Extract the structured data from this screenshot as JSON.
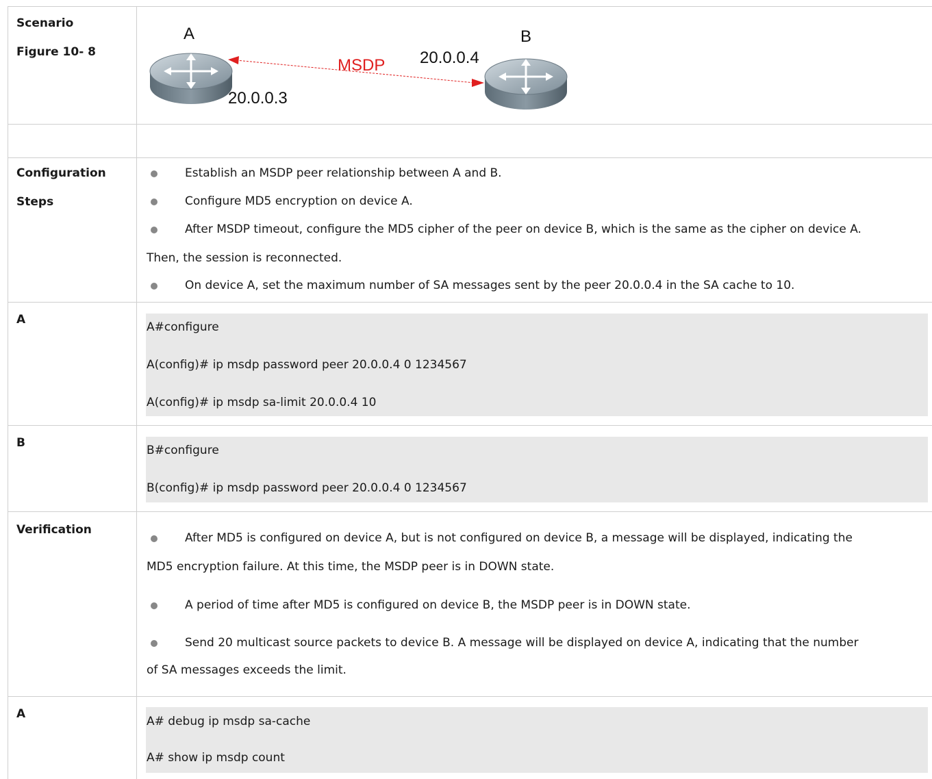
{
  "rows": {
    "scenario": {
      "label": "Scenario",
      "figure_label": "Figure 10- 8"
    },
    "config_steps": {
      "label_line1": "Configuration",
      "label_line2": "Steps",
      "items": [
        "Establish an MSDP peer relationship between A and B.",
        "Configure MD5 encryption on device A.",
        "After MSDP timeout, configure the MD5 cipher of the peer on device B, which is the same as the cipher on device A.",
        "On device A, set the maximum number of SA messages sent by the peer 20.0.0.4 in the SA cache to 10."
      ],
      "item3_continuation": "Then, the session is reconnected."
    },
    "a_config": {
      "label": "A",
      "lines": [
        "A#configure",
        "A(config)# ip msdp password peer 20.0.0.4 0 1234567",
        "A(config)# ip msdp sa-limit 20.0.0.4 10"
      ]
    },
    "b_config": {
      "label": "B",
      "lines": [
        "B#configure",
        "B(config)# ip msdp password peer 20.0.0.4 0 1234567"
      ]
    },
    "verification": {
      "label": "Verification",
      "items": [
        "After MD5 is configured on device A, but is not configured on device B, a message will be displayed, indicating the",
        "A period of time after MD5 is configured on device B, the MSDP peer is in DOWN state.",
        "Send 20 multicast source packets to device B. A message will be displayed on device A, indicating that the number"
      ],
      "item1_continuation": "MD5 encryption failure. At this time, the MSDP peer is in DOWN state.",
      "item3_continuation": "of SA messages exceeds the limit."
    },
    "a_debug": {
      "label": "A",
      "lines": [
        "A# debug ip msdp sa-cache",
        "A# show ip msdp count"
      ]
    }
  },
  "diagram": {
    "device_a_label": "A",
    "device_b_label": "B",
    "link_label": "MSDP",
    "ip_a": "20.0.0.3",
    "ip_b": "20.0.0.4",
    "link_color": "#e02020"
  }
}
